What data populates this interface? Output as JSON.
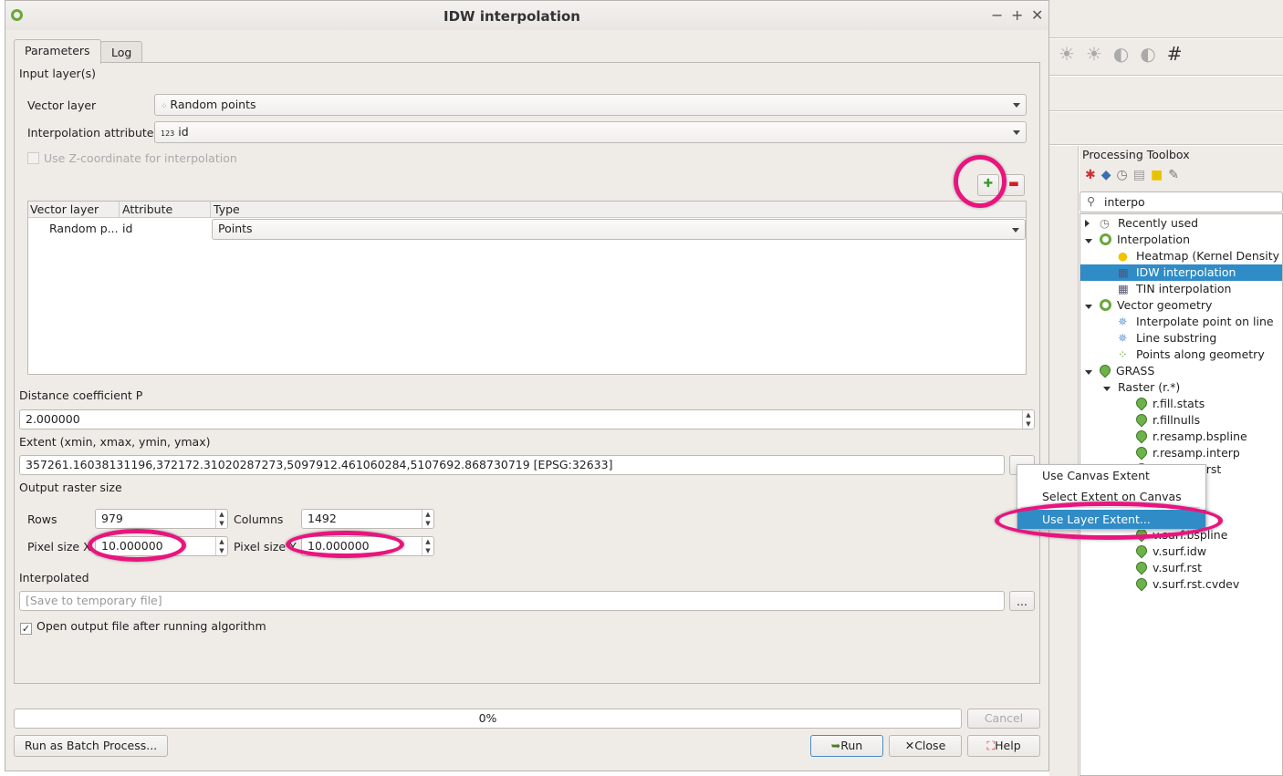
{
  "dialog": {
    "title": "IDW interpolation",
    "tabs": [
      "Parameters",
      "Log"
    ],
    "input_layers_label": "Input layer(s)",
    "vector_layer_label": "Vector layer",
    "vector_layer_value": "Random points",
    "interp_attr_label": "Interpolation attribute",
    "interp_attr_type": "123",
    "interp_attr_value": "id",
    "use_z_label": "Use Z-coordinate for interpolation",
    "use_z_checked": false,
    "table": {
      "headers": [
        "Vector layer",
        "Attribute",
        "Type"
      ],
      "rows": [
        {
          "layer": "Random p...",
          "attribute": "id",
          "type": "Points"
        }
      ]
    },
    "distance_label": "Distance coefficient P",
    "distance_value": "2.000000",
    "extent_label": "Extent (xmin, xmax, ymin, ymax)",
    "extent_value": "357261.16038131196,372172.31020287273,5097912.461060284,5107692.868730719 [EPSG:32633]",
    "extent_button": "...",
    "output_size_label": "Output raster size",
    "rows_label": "Rows",
    "rows_value": "979",
    "columns_label": "Columns",
    "columns_value": "1492",
    "pixel_x_label": "Pixel size X",
    "pixel_x_value": "10.000000",
    "pixel_y_label": "Pixel size Y",
    "pixel_y_value": "10.000000",
    "interpolated_label": "Interpolated",
    "interpolated_placeholder": "[Save to temporary file]",
    "browse_button": "...",
    "open_output_label": "Open output file after running algorithm",
    "open_output_checked": true,
    "progress_text": "0%",
    "progress": 0,
    "cancel": "Cancel",
    "batch": "Run as Batch Process...",
    "run": "Run",
    "close": "Close",
    "help": "Help"
  },
  "extent_menu": {
    "items": [
      "Use Canvas Extent",
      "Select Extent on Canvas",
      "Use Layer Extent..."
    ],
    "selected": "Use Layer Extent..."
  },
  "toolbox": {
    "title": "Processing Toolbox",
    "search": "interpo",
    "items": [
      {
        "label": "Recently used",
        "level": 0,
        "expander": "collapsed",
        "icon": "clock-icon"
      },
      {
        "label": "Interpolation",
        "level": 0,
        "expander": "expanded",
        "icon": "qgis-icon"
      },
      {
        "label": "Heatmap (Kernel Density",
        "level": 1,
        "icon": "heatmap-icon"
      },
      {
        "label": "IDW interpolation",
        "level": 1,
        "icon": "raster-icon",
        "selected": true
      },
      {
        "label": "TIN interpolation",
        "level": 1,
        "icon": "raster-icon"
      },
      {
        "label": "Vector geometry",
        "level": 0,
        "expander": "expanded",
        "icon": "qgis-icon"
      },
      {
        "label": "Interpolate point on line",
        "level": 1,
        "icon": "gear-icon"
      },
      {
        "label": "Line substring",
        "level": 1,
        "icon": "gear-icon"
      },
      {
        "label": "Points along geometry",
        "level": 1,
        "icon": "points-icon"
      },
      {
        "label": "GRASS",
        "level": 0,
        "expander": "expanded",
        "icon": "grass-icon"
      },
      {
        "label": "Raster (r.*)",
        "level": 1,
        "expander": "expanded"
      },
      {
        "label": "r.fill.stats",
        "level": 2,
        "icon": "grass-icon"
      },
      {
        "label": "r.fillnulls",
        "level": 2,
        "icon": "grass-icon"
      },
      {
        "label": "r.resamp.bspline",
        "level": 2,
        "icon": "grass-icon"
      },
      {
        "label": "r.resamp.interp",
        "level": 2,
        "icon": "grass-icon"
      },
      {
        "label": "r.resamp.rst",
        "level": 2,
        "icon": "grass-icon"
      },
      {
        "label": "",
        "level": 2
      },
      {
        "label": "",
        "level": 2
      },
      {
        "label": "",
        "level": 2
      },
      {
        "label": "v.surf.bspline",
        "level": 2,
        "icon": "grass-icon"
      },
      {
        "label": "v.surf.idw",
        "level": 2,
        "icon": "grass-icon"
      },
      {
        "label": "v.surf.rst",
        "level": 2,
        "icon": "grass-icon"
      },
      {
        "label": "v.surf.rst.cvdev",
        "level": 2,
        "icon": "grass-icon"
      }
    ]
  },
  "colors": {
    "selection": "#308cc6",
    "annotation": "#e8157e"
  }
}
